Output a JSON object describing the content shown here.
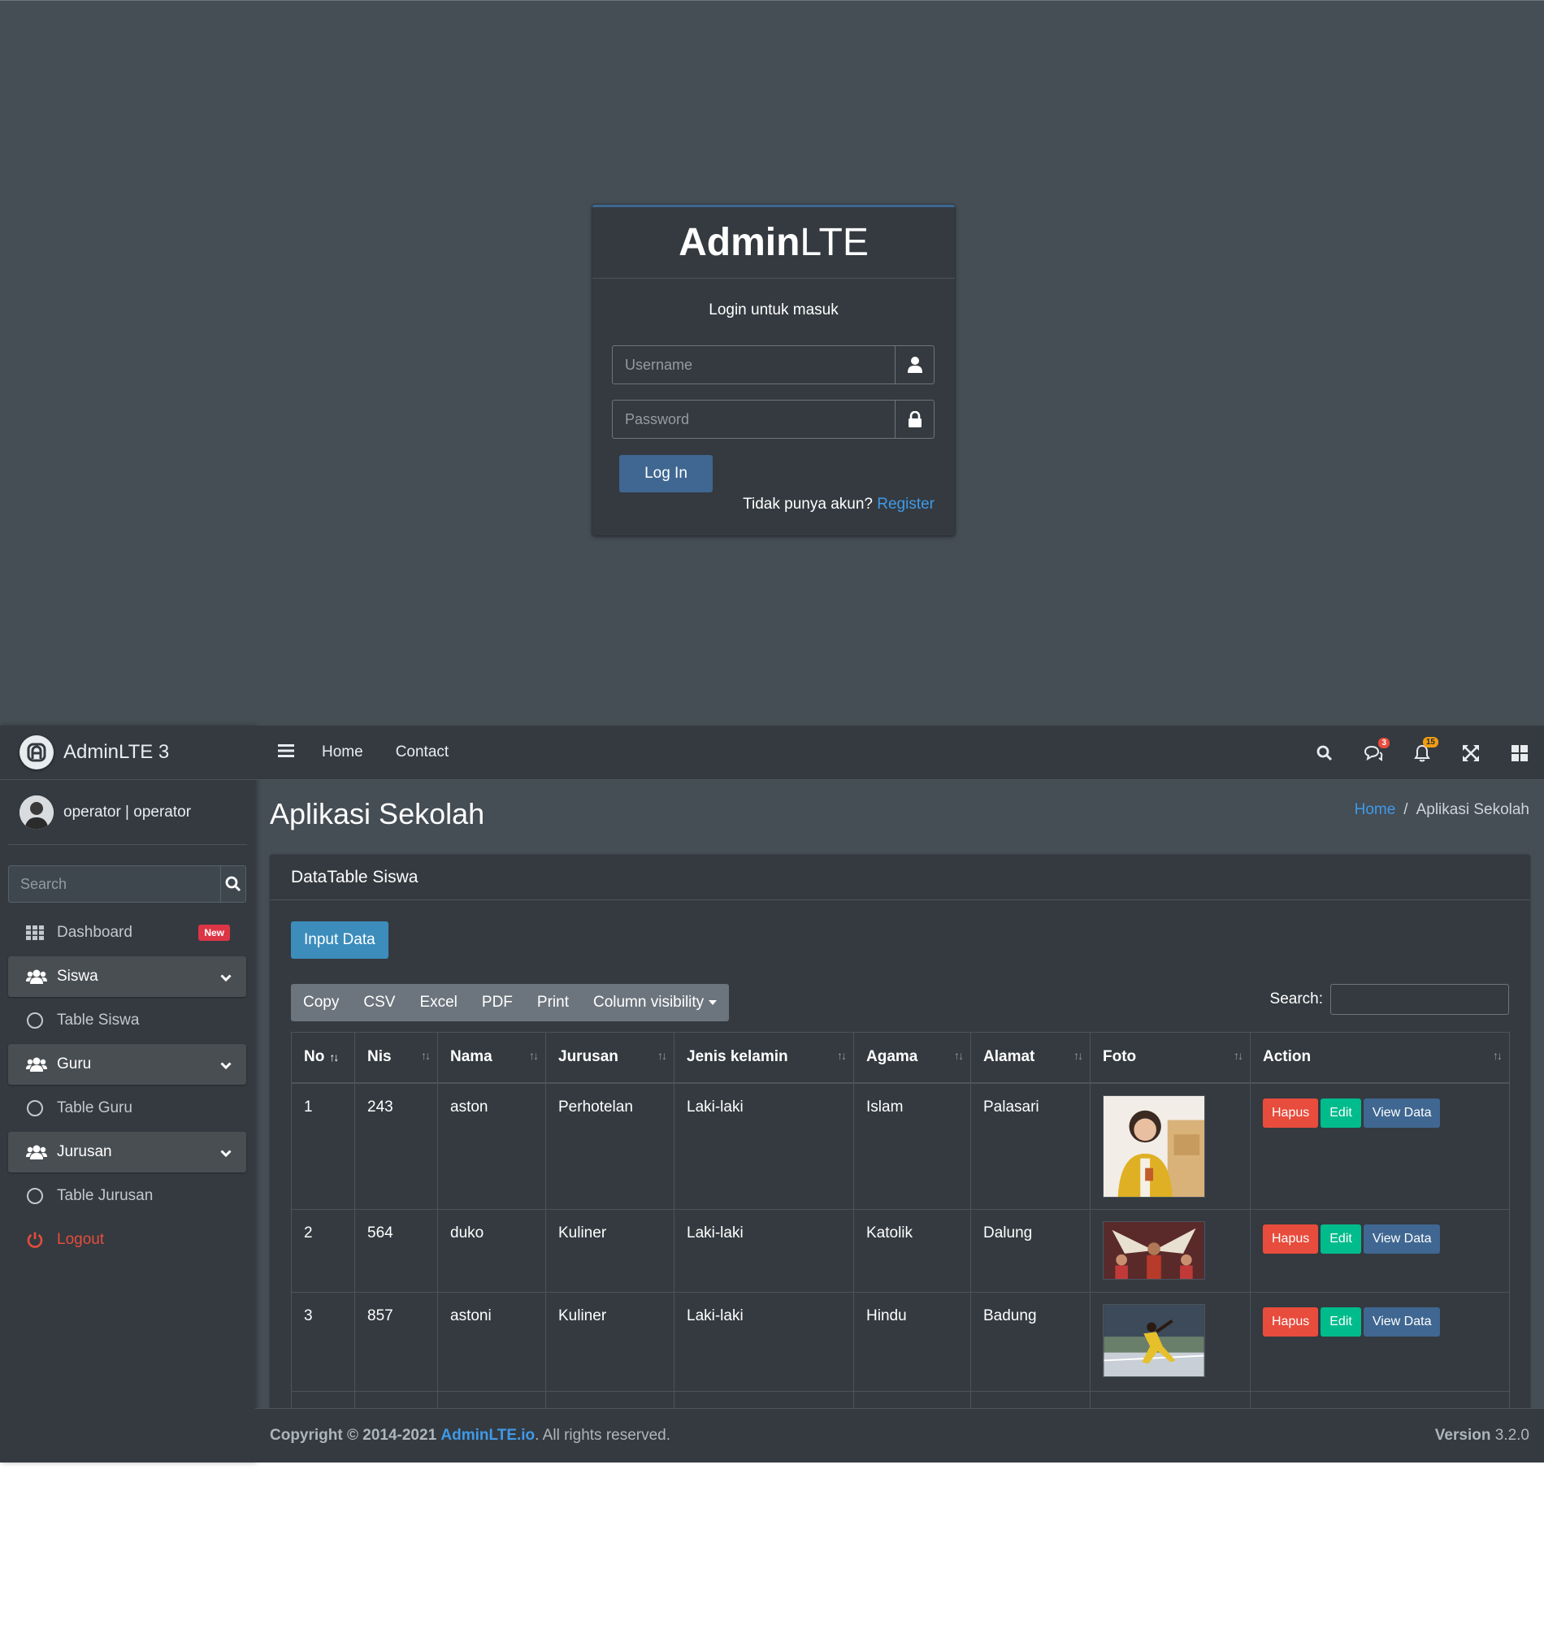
{
  "login": {
    "brand_bold": "Admin",
    "brand_light": "LTE",
    "message": "Login untuk masuk",
    "username_placeholder": "Username",
    "password_placeholder": "Password",
    "login_button": "Log In",
    "no_account": "Tidak punya akun?",
    "register": "Register"
  },
  "sidebar": {
    "brand": "AdminLTE 3",
    "user": "operator | operator",
    "search_placeholder": "Search",
    "items": [
      {
        "label": "Dashboard",
        "badge": "New"
      },
      {
        "label": "Siswa"
      },
      {
        "label": "Table Siswa"
      },
      {
        "label": "Guru"
      },
      {
        "label": "Table Guru"
      },
      {
        "label": "Jurusan"
      },
      {
        "label": "Table Jurusan"
      },
      {
        "label": "Logout"
      }
    ]
  },
  "topbar": {
    "links": [
      "Home",
      "Contact"
    ],
    "messages_count": "3",
    "notifications_count": "15"
  },
  "content": {
    "title": "Aplikasi Sekolah",
    "breadcrumb_home": "Home",
    "breadcrumb_current": "Aplikasi Sekolah",
    "card_title": "DataTable Siswa",
    "input_button": "Input Data",
    "dt_buttons": [
      "Copy",
      "CSV",
      "Excel",
      "PDF",
      "Print",
      "Column visibility"
    ],
    "search_label": "Search:",
    "columns": [
      "No",
      "Nis",
      "Nama",
      "Jurusan",
      "Jenis kelamin",
      "Agama",
      "Alamat",
      "Foto",
      "Action"
    ],
    "rows": [
      {
        "no": "1",
        "nis": "243",
        "nama": "aston",
        "jurusan": "Perhotelan",
        "jk": "Laki-laki",
        "agama": "Islam",
        "alamat": "Palasari"
      },
      {
        "no": "2",
        "nis": "564",
        "nama": "duko",
        "jurusan": "Kuliner",
        "jk": "Laki-laki",
        "agama": "Katolik",
        "alamat": "Dalung"
      },
      {
        "no": "3",
        "nis": "857",
        "nama": "astoni",
        "jurusan": "Kuliner",
        "jk": "Laki-laki",
        "agama": "Hindu",
        "alamat": "Badung"
      }
    ],
    "actions": {
      "delete": "Hapus",
      "edit": "Edit",
      "view": "View Data"
    }
  },
  "footer": {
    "copyright": "Copyright © 2014-2021",
    "link": "AdminLTE.io",
    "rights": ". All rights reserved.",
    "version_label": "Version",
    "version": "3.2.0"
  },
  "colors": {
    "bg": "#454d55",
    "panel": "#343a40",
    "primary": "#3f6791",
    "info": "#3c8dbc",
    "danger": "#e74c3c",
    "success": "#00bc8c",
    "link": "#3f9ae8"
  }
}
